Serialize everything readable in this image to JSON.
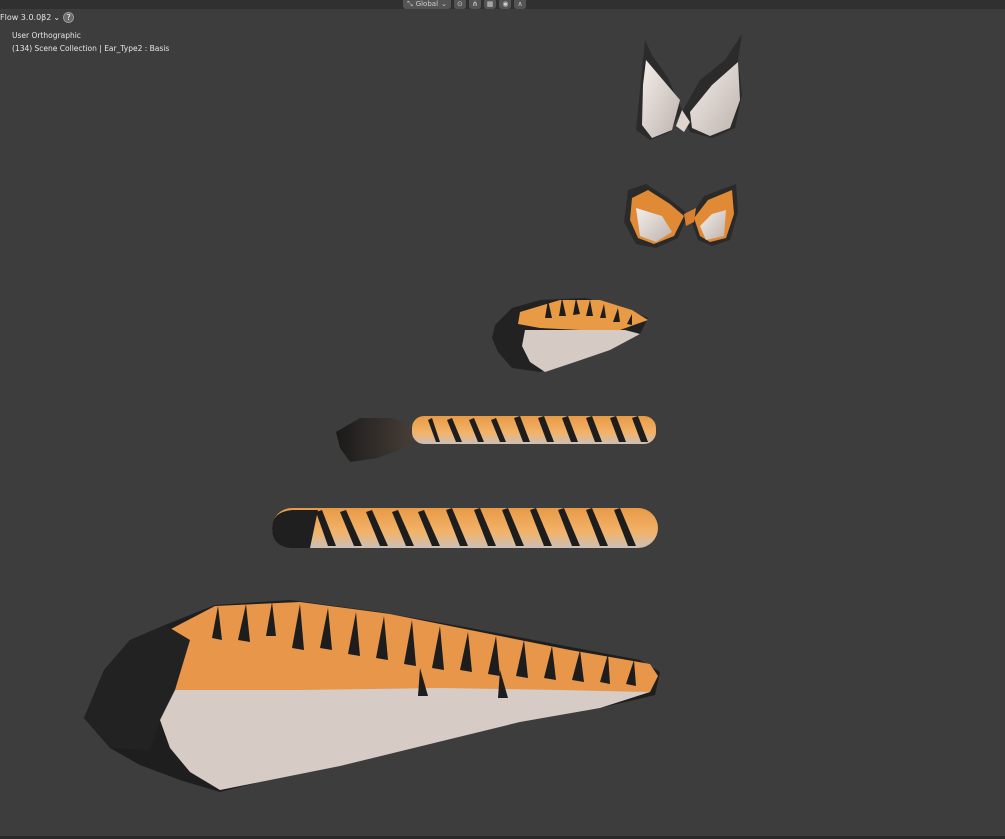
{
  "header": {
    "orientation_label": "Global",
    "orientation_icon": "transform-orientation-icon",
    "pivot_icon": "pivot-point-icon",
    "snap_icon": "snap-icon",
    "proportional_icon": "proportional-editing-icon"
  },
  "addon": {
    "name": "Flow 3.0.0β2",
    "help_glyph": "?"
  },
  "viewport": {
    "view_name": "User Orthographic",
    "object_info": "(134) Scene Collection | Ear_Type2 : Basis"
  },
  "colors": {
    "background": "#3d3d3d",
    "fur_orange": "#e89a45",
    "fur_white": "#d9cfc8",
    "fur_dark": "#1e1e1e"
  }
}
